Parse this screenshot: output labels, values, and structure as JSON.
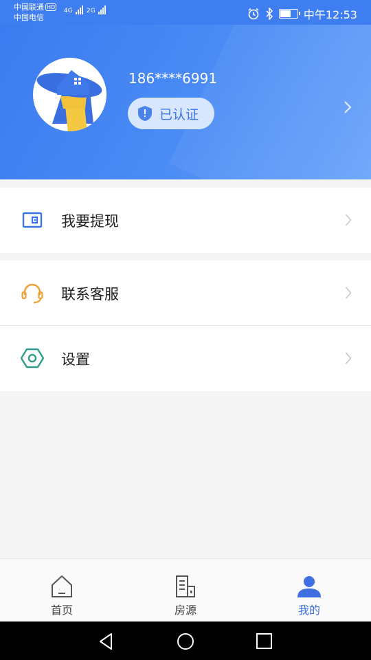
{
  "status_bar": {
    "carrier1": "中国联通",
    "hd": "HD",
    "carrier2": "中国电信",
    "net1": "4G",
    "net2": "2G",
    "time": "中午12:53"
  },
  "profile": {
    "phone": "186****6991",
    "verified_label": "已认证"
  },
  "menu": {
    "withdraw": "我要提现",
    "support": "联系客服",
    "settings": "设置"
  },
  "bottom_nav": [
    {
      "label": "首页",
      "icon": "home-icon"
    },
    {
      "label": "房源",
      "icon": "building-icon"
    },
    {
      "label": "我的",
      "icon": "person-icon"
    }
  ],
  "colors": {
    "header_blue": "#3f7ef0",
    "active_tab": "#3f6fe0",
    "support_orange": "#f0a032",
    "settings_teal": "#2e9e8a"
  }
}
